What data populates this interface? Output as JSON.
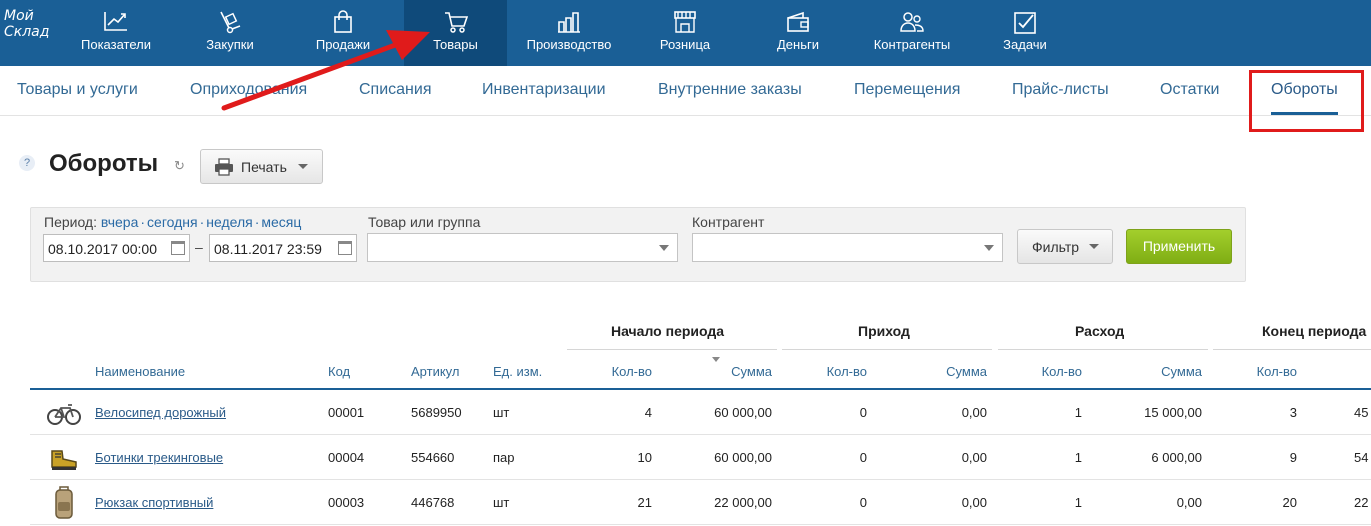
{
  "app": {
    "logo_line1": "Мой",
    "logo_line2": "Склад"
  },
  "topnav": [
    {
      "label": "Показатели",
      "icon": "chart-icon"
    },
    {
      "label": "Закупки",
      "icon": "cart-dolly-icon"
    },
    {
      "label": "Продажи",
      "icon": "shopping-bag-icon"
    },
    {
      "label": "Товары",
      "icon": "shopping-cart-icon",
      "active": true
    },
    {
      "label": "Производство",
      "icon": "factory-icon"
    },
    {
      "label": "Розница",
      "icon": "store-icon"
    },
    {
      "label": "Деньги",
      "icon": "wallet-icon"
    },
    {
      "label": "Контрагенты",
      "icon": "people-icon"
    },
    {
      "label": "Задачи",
      "icon": "checkbox-icon"
    }
  ],
  "subnav": [
    {
      "label": "Товары и услуги"
    },
    {
      "label": "Оприходования"
    },
    {
      "label": "Списания"
    },
    {
      "label": "Инвентаризации"
    },
    {
      "label": "Внутренние заказы"
    },
    {
      "label": "Перемещения"
    },
    {
      "label": "Прайс-листы"
    },
    {
      "label": "Остатки"
    },
    {
      "label": "Обороты",
      "active": true
    }
  ],
  "page": {
    "help": "?",
    "title": "Обороты",
    "print_label": "Печать"
  },
  "filter": {
    "period_label": "Период:",
    "period_links": [
      "вчера",
      "сегодня",
      "неделя",
      "месяц"
    ],
    "date_from": "08.10.2017 00:00",
    "date_to": "08.11.2017 23:59",
    "dash": "–",
    "product_label": "Товар или группа",
    "counterparty_label": "Контрагент",
    "filter_button": "Фильтр",
    "apply_button": "Применить"
  },
  "table": {
    "groups": [
      "Начало периода",
      "Приход",
      "Расход",
      "Конец периода"
    ],
    "headers": [
      "Наименование",
      "Код",
      "Артикул",
      "Ед. изм.",
      "Кол-во",
      "Сумма",
      "Кол-во",
      "Сумма",
      "Кол-во",
      "Сумма",
      "Кол-во"
    ],
    "rows": [
      {
        "image": "bicycle-icon",
        "name": "Велосипед дорожный",
        "code": "00001",
        "article": "5689950",
        "unit": "шт",
        "start_qty": "4",
        "start_sum": "60 000,00",
        "in_qty": "0",
        "in_sum": "0,00",
        "out_qty": "1",
        "out_sum": "15 000,00",
        "end_qty": "3",
        "end_sum_partial": "45"
      },
      {
        "image": "boots-icon",
        "name": "Ботинки трекинговые",
        "code": "00004",
        "article": "554660",
        "unit": "пар",
        "start_qty": "10",
        "start_sum": "60 000,00",
        "in_qty": "0",
        "in_sum": "0,00",
        "out_qty": "1",
        "out_sum": "6 000,00",
        "end_qty": "9",
        "end_sum_partial": "54"
      },
      {
        "image": "backpack-icon",
        "name": "Рюкзак спортивный",
        "code": "00003",
        "article": "446768",
        "unit": "шт",
        "start_qty": "21",
        "start_sum": "22 000,00",
        "in_qty": "0",
        "in_sum": "0,00",
        "out_qty": "1",
        "out_sum": "0,00",
        "end_qty": "20",
        "end_sum_partial": "22"
      }
    ]
  },
  "colors": {
    "nav_bg": "#1a5f96",
    "nav_active": "#0f4a7a",
    "apply_green": "#8fbf1f",
    "highlight_red": "#e01b1b"
  }
}
